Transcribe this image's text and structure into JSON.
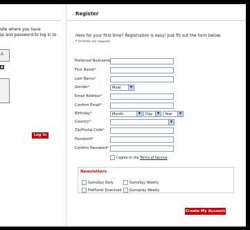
{
  "login": {
    "intro": "site where you have\nss and password to log in to",
    "box_label": "A",
    "button": "Log In"
  },
  "register": {
    "title": "Register",
    "intro": "Here for your first time? Registration is easy! Just fill out the form below.",
    "required_note": "* All fields are required.",
    "fields": {
      "nickname": "Preferred Nickname",
      "first_name": "First Name",
      "last_name": "Last Name",
      "gender": "Gender",
      "email": "Email Address",
      "confirm_email": "Confirm Email",
      "birthday": "Birthday",
      "country": "Country",
      "zip": "Zip/Postal Code",
      "password": "Password",
      "confirm_password": "Confirm Password"
    },
    "gender_value": "Male",
    "birthday_month": "Month",
    "birthday_day": "Day",
    "birthday_year": "Year",
    "country_value": "",
    "agree_prefix": "I agree to the",
    "agree_link": "Terms of Service",
    "newsletters": {
      "title": "Newsletters",
      "items": [
        "GameSpy Daily",
        "GameSpy Weekly",
        "FilePlanet Download",
        "Gameplay Weekly"
      ]
    },
    "create_button": "Create My Account"
  },
  "colors": {
    "accent_red": "#cc0000",
    "input_border": "#7f9db9"
  },
  "icons": {
    "dropdown": "chevron-down-icon",
    "checkbox": "checkbox-icon"
  }
}
